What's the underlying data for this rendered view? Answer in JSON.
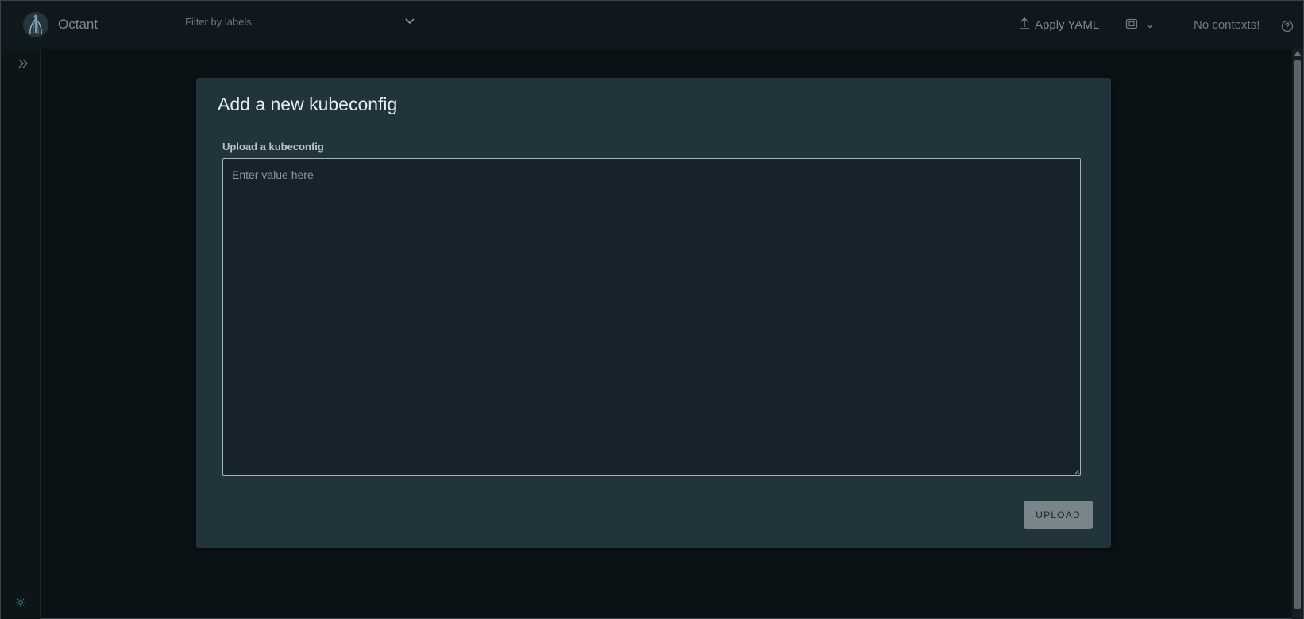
{
  "app": {
    "name": "Octant"
  },
  "header": {
    "label_filter_placeholder": "Filter by labels",
    "apply_yaml_label": "Apply YAML",
    "context_status": "No contexts!"
  },
  "modal": {
    "title": "Add a new kubeconfig",
    "field_label": "Upload a kubeconfig",
    "textarea_placeholder": "Enter value here",
    "textarea_value": "",
    "upload_button_label": "UPLOAD"
  },
  "icons": {
    "logo": "octant-logo-icon",
    "filter_dropdown": "chevron-down-icon",
    "apply_yaml": "upload-icon",
    "namespace": "namespace-icon",
    "namespace_dropdown": "chevron-down-icon",
    "help": "help-circle-icon",
    "nav_expand": "double-chevron-right-icon",
    "settings": "gear-icon"
  },
  "colors": {
    "background": "#0b1215",
    "header_bg": "#0f181c",
    "modal_bg": "#21333b",
    "textarea_bg": "#17232a",
    "upload_button_bg": "#7a8589",
    "text_primary": "#e6ecef",
    "text_muted": "#7d8a90"
  }
}
